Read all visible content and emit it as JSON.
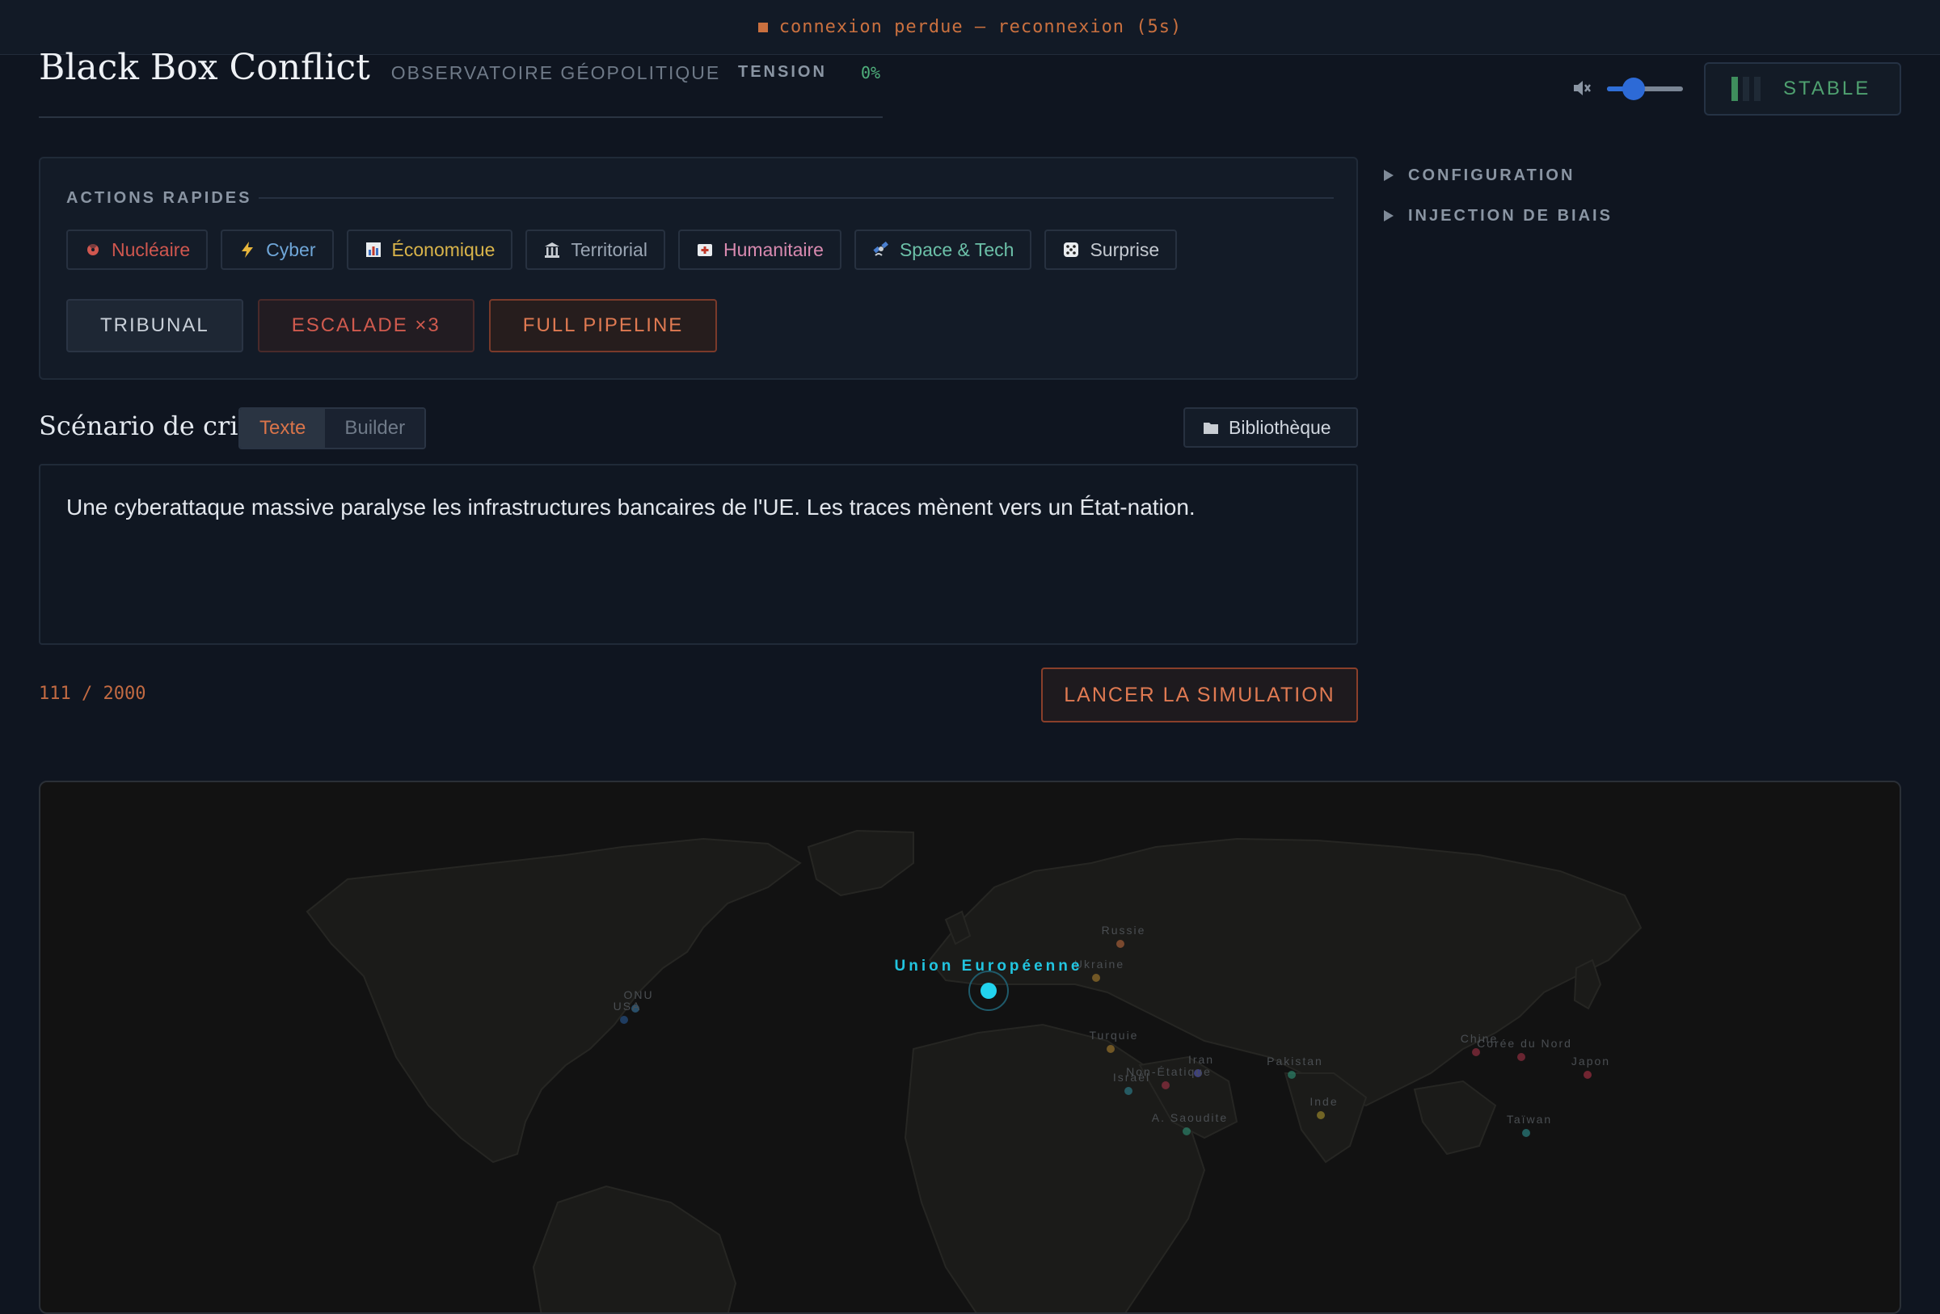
{
  "banner": {
    "text": "connexion perdue — reconnexion (5s)"
  },
  "header": {
    "title": "Black Box Conflict",
    "subtitle": "OBSERVATOIRE GÉOPOLITIQUE",
    "tension_label": "TENSION",
    "tension_value": "0%",
    "status": "STABLE",
    "volume_percent": 35
  },
  "side_menu": {
    "items": [
      {
        "label": "CONFIGURATION"
      },
      {
        "label": "INJECTION DE BIAIS"
      }
    ]
  },
  "quick_actions": {
    "title": "ACTIONS RAPIDES",
    "chips": [
      {
        "label": "Nucléaire",
        "icon": "radiation-icon",
        "color": "#d0574f"
      },
      {
        "label": "Cyber",
        "icon": "lightning-icon",
        "color": "#6fa6d8"
      },
      {
        "label": "Économique",
        "icon": "bar-chart-icon",
        "color": "#d9b44a"
      },
      {
        "label": "Territorial",
        "icon": "building-icon",
        "color": "#9aa5b3"
      },
      {
        "label": "Humanitaire",
        "icon": "first-aid-icon",
        "color": "#d98ab0"
      },
      {
        "label": "Space & Tech",
        "icon": "satellite-icon",
        "color": "#6cc0a8"
      },
      {
        "label": "Surprise",
        "icon": "dice-icon",
        "color": "#c4c9d0"
      }
    ],
    "buttons": [
      {
        "label": "TRIBUNAL",
        "color": "#c9d0d9"
      },
      {
        "label": "ESCALADE ×3",
        "color": "#d05a4e"
      },
      {
        "label": "FULL PIPELINE",
        "color": "#e07a52"
      }
    ]
  },
  "scenario": {
    "title": "Scénario de crise",
    "tab_text": "Texte",
    "tab_builder": "Builder",
    "library": "Bibliothèque",
    "text": "Une cyberattaque massive paralyse les infrastructures bancaires de l'UE. Les traces mènent vers un État-nation.",
    "counter": "111 / 2000",
    "launch": "LANCER LA SIMULATION"
  },
  "map": {
    "focus": "Union Européenne",
    "actors": [
      "Russie",
      "Ukraine",
      "ONU",
      "USA",
      "Turquie",
      "Iran",
      "Non-Étatique",
      "Israël",
      "Pakistan",
      "Inde",
      "A. Saoudite",
      "Chine",
      "Corée du Nord",
      "Japon",
      "Taïwan"
    ]
  }
}
